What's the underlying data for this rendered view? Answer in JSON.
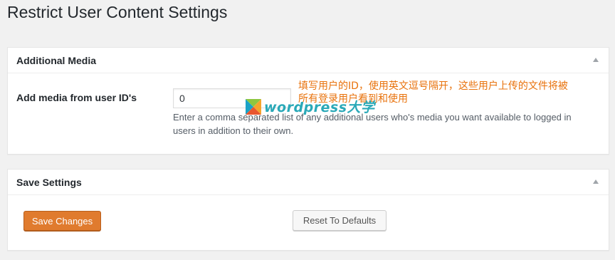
{
  "page": {
    "title": "Restrict User Content Settings"
  },
  "media_box": {
    "title": "Additional Media",
    "field_label": "Add media from user ID's",
    "field_value": "0",
    "description": "Enter a comma separated list of any additional users who's media you want available to logged in users in addition to their own.",
    "annotation": "填写用户的ID，使用英文逗号隔开，这些用户上传的文件将被所有登录用户看到和使用"
  },
  "watermark": {
    "text": "wordpress大学"
  },
  "save_box": {
    "title": "Save Settings",
    "save_label": "Save Changes",
    "reset_label": "Reset To Defaults"
  },
  "colors": {
    "primary_button": "#e07b2e",
    "annotation": "#e8720c",
    "watermark": "#2aa9b8"
  },
  "icons": {
    "toggle": "triangle-up-icon",
    "logo": "wordpress-daxue-logo"
  }
}
